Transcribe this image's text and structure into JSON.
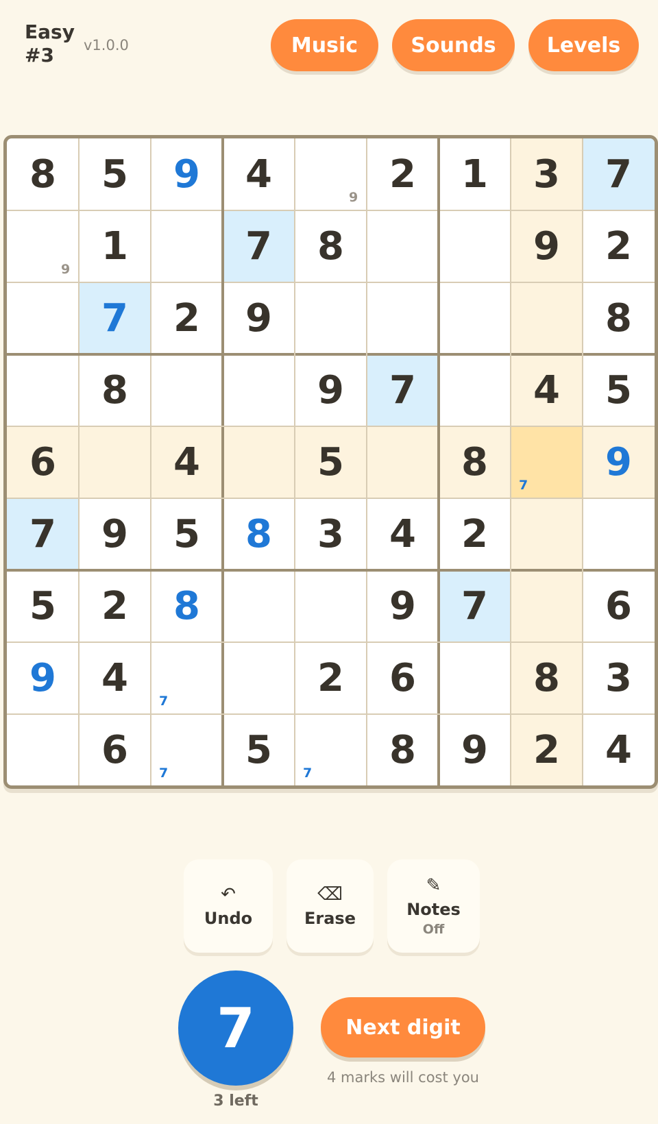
{
  "header": {
    "level": "Easy\n#3",
    "version": "v1.0.0"
  },
  "top_buttons": {
    "music": "Music",
    "sounds": "Sounds",
    "levels": "Levels"
  },
  "board": {
    "rows": [
      [
        "8",
        "5",
        "9",
        "4",
        "",
        "2",
        "1",
        "3",
        "7"
      ],
      [
        "",
        "1",
        "",
        "7",
        "8",
        "",
        "",
        "9",
        "2"
      ],
      [
        "",
        "7",
        "2",
        "9",
        "",
        "",
        "",
        "",
        "8"
      ],
      [
        "",
        "8",
        "",
        "",
        "9",
        "7",
        "",
        "4",
        "5"
      ],
      [
        "6",
        "",
        "4",
        "",
        "5",
        "",
        "8",
        "",
        "9"
      ],
      [
        "7",
        "9",
        "5",
        "8",
        "3",
        "4",
        "2",
        "",
        ""
      ],
      [
        "5",
        "2",
        "8",
        "",
        "",
        "9",
        "7",
        "",
        "6"
      ],
      [
        "9",
        "4",
        "",
        "",
        "2",
        "6",
        "",
        "8",
        "3"
      ],
      [
        "",
        "6",
        "",
        "5",
        "",
        "8",
        "9",
        "2",
        "4"
      ]
    ],
    "blue_digits": [
      [
        0,
        2
      ],
      [
        2,
        1
      ],
      [
        4,
        8
      ],
      [
        5,
        3
      ],
      [
        6,
        2
      ],
      [
        7,
        0
      ]
    ],
    "notes": [
      {
        "r": 0,
        "c": 4,
        "v": "9",
        "color": "gray"
      },
      {
        "r": 1,
        "c": 0,
        "v": "9",
        "color": "gray"
      },
      {
        "r": 4,
        "c": 7,
        "v": "7",
        "color": "blue"
      },
      {
        "r": 7,
        "c": 2,
        "v": "7",
        "color": "blue"
      },
      {
        "r": 8,
        "c": 2,
        "v": "7",
        "color": "blue"
      },
      {
        "r": 8,
        "c": 4,
        "v": "7",
        "color": "blue"
      }
    ],
    "selected": [
      4,
      7
    ],
    "same_digit_cells": [
      [
        0,
        8
      ],
      [
        1,
        3
      ],
      [
        2,
        1
      ],
      [
        3,
        5
      ],
      [
        5,
        0
      ],
      [
        6,
        6
      ]
    ],
    "colors": {
      "given": "#38332b",
      "player": "#1f78d6",
      "highlight": "#fdf3de",
      "same": "#d9effc",
      "selected": "#ffe3a6"
    }
  },
  "tools": {
    "undo": {
      "icon": "undo-icon",
      "glyph": "↶",
      "label": "Undo"
    },
    "erase": {
      "icon": "erase-icon",
      "glyph": "⌫",
      "label": "Erase"
    },
    "notes": {
      "icon": "pencil-icon",
      "glyph": "✎",
      "label": "Notes",
      "state": "Off"
    }
  },
  "digit_picker": {
    "current": "7",
    "remaining": "3 left",
    "next_label": "Next digit",
    "cost_text": "4 marks will cost you"
  },
  "accent": "#ff8a3d"
}
